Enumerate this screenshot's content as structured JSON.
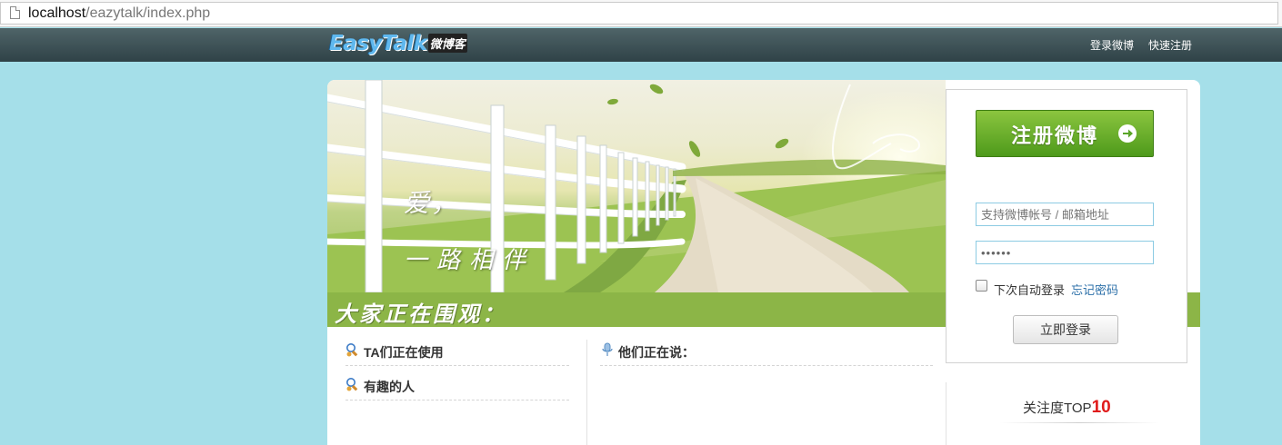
{
  "browser": {
    "url_host": "localhost",
    "url_path": "/eazytalk/index.php"
  },
  "header": {
    "logo_en": "EasyTalk",
    "logo_cn": "微博客",
    "login_link": "登录微博",
    "register_link": "快速注册"
  },
  "banner": {
    "slogan_line1": "爱，",
    "slogan_line2": "一路相伴"
  },
  "section_bar": {
    "title": "大家正在围观："
  },
  "left_column": {
    "items": [
      {
        "label": "TA们正在使用"
      },
      {
        "label": "有趣的人"
      }
    ]
  },
  "middle_column": {
    "title": "他们正在说："
  },
  "login": {
    "register_button": "注册微博",
    "username_placeholder": "支持微博帐号 / 邮箱地址",
    "password_value": "••••••",
    "remember_label": "下次自动登录",
    "forgot_link": "忘记密码",
    "submit_button": "立即登录"
  },
  "top10": {
    "label": "关注度TOP",
    "number": "10"
  },
  "colors": {
    "page_bg": "#a5dfe9",
    "nav_bg": "#3a4e52",
    "green_bar": "#8cb547",
    "register_green": "#5aa528",
    "link_blue": "#2b6fa8",
    "accent_red": "#e01b1b"
  }
}
